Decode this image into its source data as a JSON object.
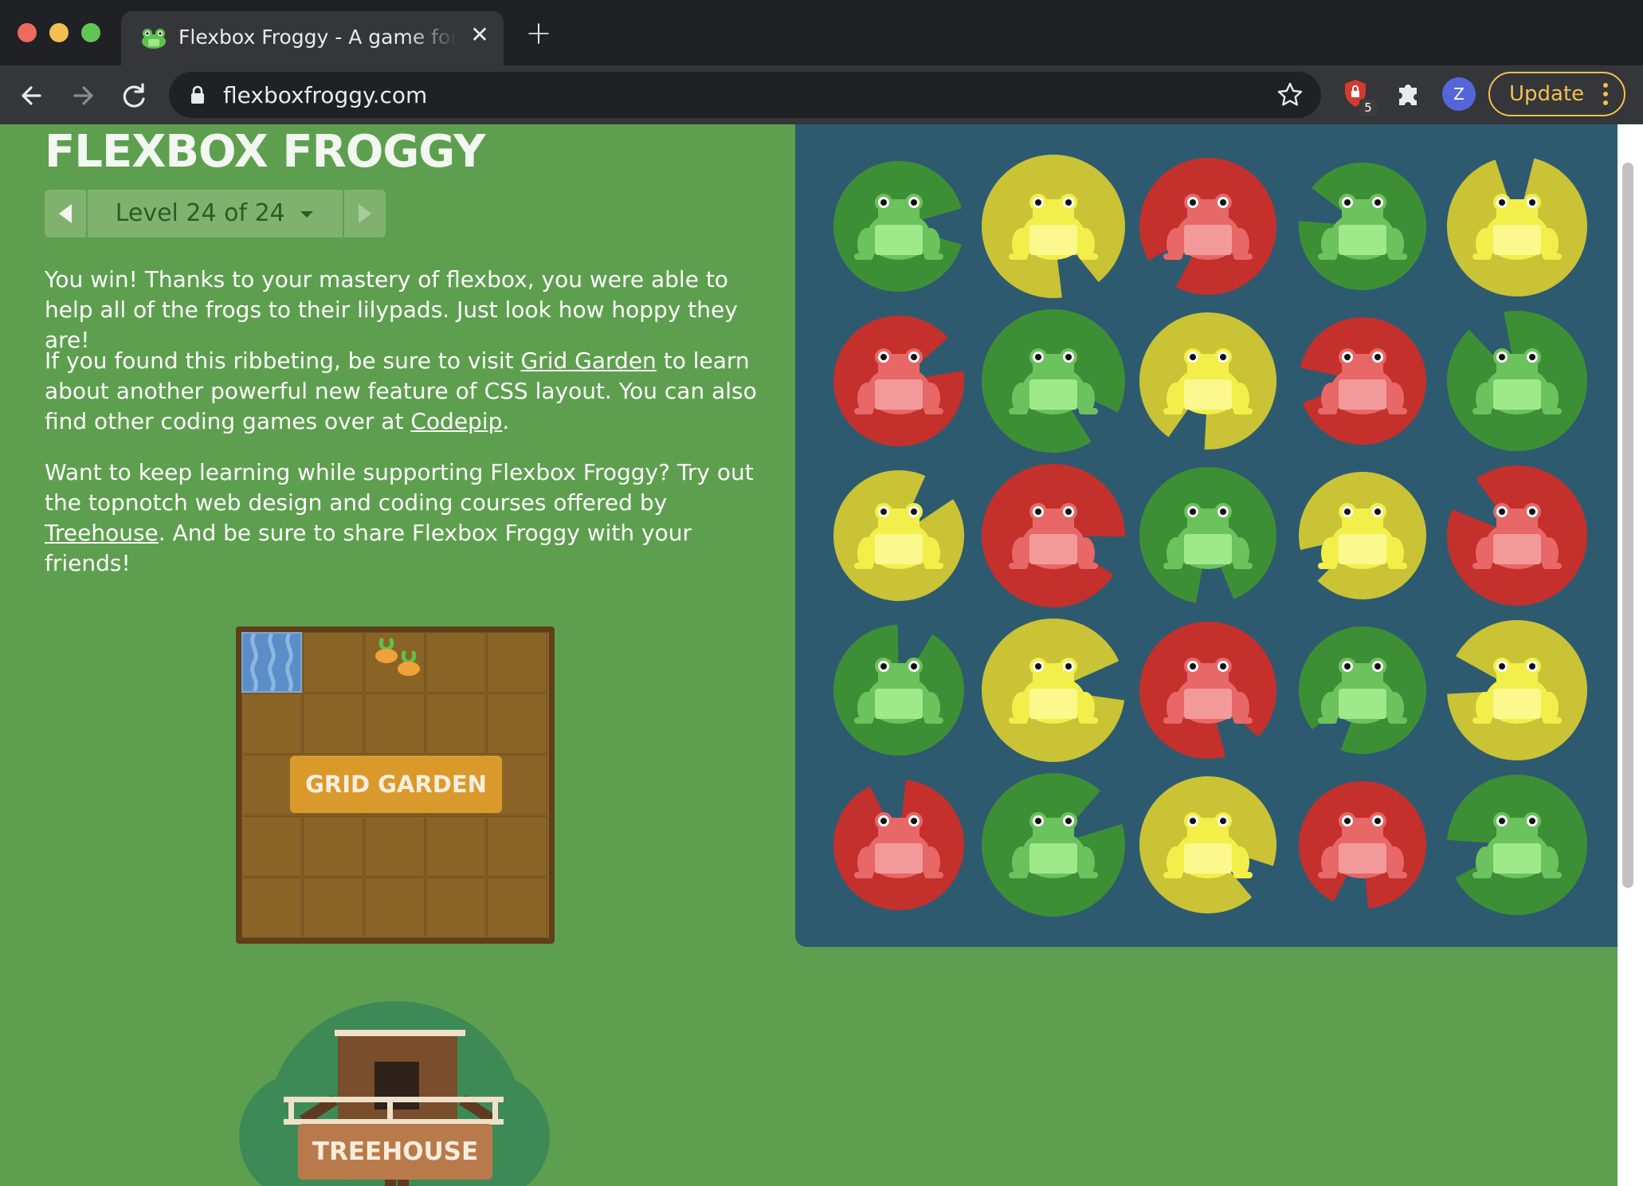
{
  "browser": {
    "tab_title": "Flexbox Froggy - A game for learning CSS flexbox",
    "tab_close": "✕",
    "new_tab": "+",
    "url": "flexboxfroggy.com",
    "extension_badge": "5",
    "avatar_letter": "Z",
    "update_label": "Update"
  },
  "page": {
    "title": "FLEXBOX FROGGY",
    "level_label": "Level 24 of 24",
    "para1": "You win! Thanks to your mastery of flexbox, you were able to help all of the frogs to their lilypads. Just look how hoppy they are!",
    "para2_a": "If you found this ribbeting, be sure to visit ",
    "link_grid_garden": "Grid Garden",
    "para2_b": " to learn about another powerful new feature of CSS layout. You can also find other coding games over at ",
    "link_codepip": "Codepip",
    "para2_c": ".",
    "para3_a": "Want to keep learning while supporting Flexbox Froggy? Try out the topnotch web design and coding courses offered by ",
    "link_treehouse": "Treehouse",
    "para3_b": ". And be sure to share Flexbox Froggy with your friends!",
    "grid_garden_button": "GRID GARDEN",
    "treehouse_button": "TREEHOUSE"
  },
  "pond": {
    "rows": [
      [
        "green",
        "yellow",
        "red",
        "green",
        "yellow"
      ],
      [
        "red",
        "green",
        "yellow",
        "red",
        "green"
      ],
      [
        "yellow",
        "red",
        "green",
        "yellow",
        "red"
      ],
      [
        "green",
        "yellow",
        "red",
        "green",
        "yellow"
      ],
      [
        "red",
        "green",
        "yellow",
        "red",
        "green"
      ]
    ],
    "colors": {
      "green": {
        "pad": "#3d8f35",
        "frog": "#6cc25c",
        "belly": "#9ee98a"
      },
      "yellow": {
        "pad": "#c9c335",
        "frog": "#f3ef4a",
        "belly": "#fbf88d"
      },
      "red": {
        "pad": "#c4302b",
        "frog": "#e86767",
        "belly": "#f29a9a"
      }
    }
  },
  "colors": {
    "page_bg": "#5d9f4e",
    "pond_bg": "#2e5a70",
    "update_accent": "#f2c14e"
  }
}
